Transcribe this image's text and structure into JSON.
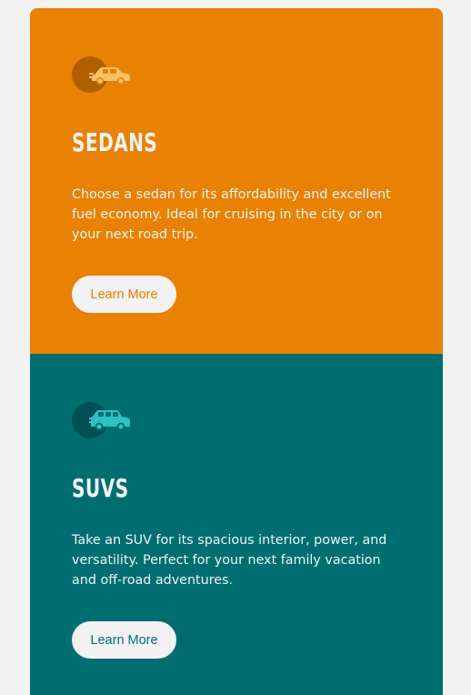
{
  "cards": [
    {
      "title": "SEDANS",
      "description": "Choose a sedan for its affordability and excellent fuel economy. Ideal for cruising in the city or on your next road trip.",
      "button_label": "Learn More",
      "icon": "sedan-car-icon",
      "bg_color": "#e98102",
      "accent_color": "#e98102",
      "icon_color": "#f7c26a",
      "icon_circle_color": "#b05f00"
    },
    {
      "title": "SUVS",
      "description": "Take an SUV for its spacious interior, power, and versatility. Perfect for your next family vacation and off-road adventures.",
      "button_label": "Learn More",
      "icon": "suv-car-icon",
      "bg_color": "#006e71",
      "accent_color": "#006e71",
      "icon_color": "#2ec2c2",
      "icon_circle_color": "#004f52"
    }
  ]
}
